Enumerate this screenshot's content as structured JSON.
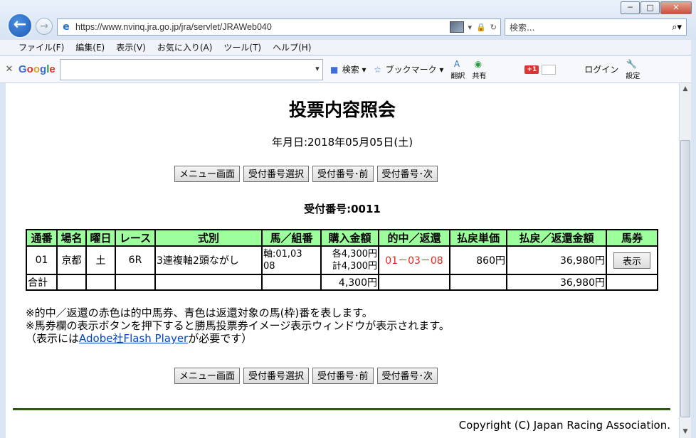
{
  "browser": {
    "url": "https://www.nvinq.jra.go.jp/jra/servlet/JRAWeb040",
    "search_placeholder": "検索...",
    "menu": [
      "ファイル(F)",
      "編集(E)",
      "表示(V)",
      "お気に入り(A)",
      "ツール(T)",
      "ヘルプ(H)"
    ],
    "google_toolbar": {
      "logo": "Google",
      "search_label": "検索",
      "bookmark_label": "ブックマーク",
      "translate_label": "翻訳",
      "share_label": "共有",
      "gplus_label": "+1",
      "login_label": "ログイン",
      "settings_label": "設定"
    }
  },
  "page": {
    "title": "投票内容照会",
    "date_line": "年月日:2018年05月05日(土)",
    "buttons": [
      "メニュー画面",
      "受付番号選択",
      "受付番号･前",
      "受付番号･次"
    ],
    "receipt_line": "受付番号:0011",
    "table": {
      "headers": [
        "通番",
        "場名",
        "曜日",
        "レース",
        "式別",
        "馬／組番",
        "購入金額",
        "的中／返還",
        "払戻単価",
        "払戻／返還金額",
        "馬券"
      ],
      "row": {
        "no": "01",
        "venue": "京都",
        "day": "土",
        "race": "6R",
        "bet_type": "3連複軸2頭ながし",
        "combo_line1": "軸:01,03",
        "combo_line2": "08",
        "amount_line1": "各4,300円",
        "amount_line2": "計4,300円",
        "hit": "01－03－08",
        "unit_payout": "860円",
        "payout": "36,980円",
        "ticket_button": "表示"
      },
      "total": {
        "label": "合計",
        "amount": "4,300円",
        "payout": "36,980円"
      }
    },
    "notes": [
      "※的中／返還の赤色は的中馬券、青色は返還対象の馬(枠)番を表します。",
      "※馬券欄の表示ボタンを押下すると勝馬投票券イメージ表示ウィンドウが表示されます。"
    ],
    "flash_note_prefix": "（表示には",
    "flash_link": "Adobe社Flash Player",
    "flash_note_suffix": "が必要です）",
    "copyright": "Copyright (C) Japan Racing Association."
  },
  "colors": {
    "header_bg": "#9cff9c",
    "hit_red": "#e0261f",
    "footer_line": "#2e5c0e"
  }
}
